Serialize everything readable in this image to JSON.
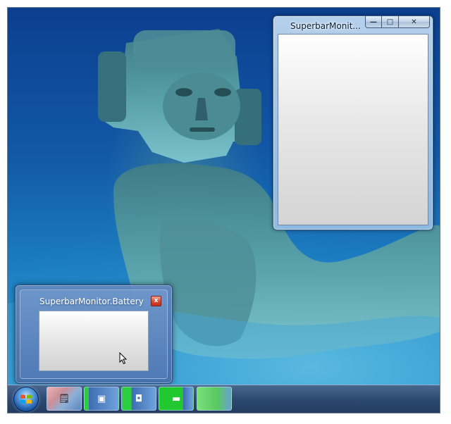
{
  "window": {
    "title": "SuperbarMonit...",
    "minimize_glyph": "—",
    "maximize_glyph": "□",
    "close_glyph": "✕"
  },
  "thumbnail": {
    "title": "SuperbarMonitor.Battery",
    "close_glyph": "x"
  },
  "taskbar": {
    "start_icon": "windows-logo-icon",
    "buttons": [
      {
        "name": "taskbar-button-battery",
        "icon": "battery-clipboard-icon",
        "glyph": "🗒"
      },
      {
        "name": "taskbar-button-cpu",
        "icon": "cpu-chip-icon",
        "glyph": "▣"
      },
      {
        "name": "taskbar-button-disk",
        "icon": "disk-icon",
        "glyph": "◘"
      },
      {
        "name": "taskbar-button-memory",
        "icon": "memory-stick-icon",
        "glyph": "▬"
      },
      {
        "name": "taskbar-button-network",
        "icon": "blank-icon",
        "glyph": ""
      }
    ]
  },
  "colors": {
    "desktop_blue": "#1259a8",
    "taskbar": "#28466e",
    "progress_green": "#2ecc40",
    "close_red": "#d9462f"
  }
}
